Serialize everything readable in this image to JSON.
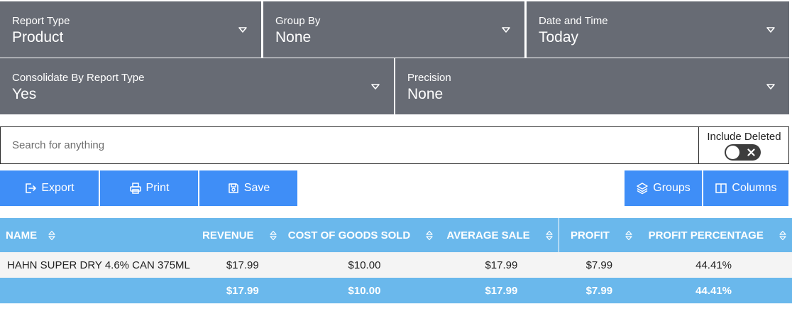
{
  "filters": {
    "report_type": {
      "label": "Report Type",
      "value": "Product"
    },
    "group_by": {
      "label": "Group By",
      "value": "None"
    },
    "date_time": {
      "label": "Date and Time",
      "value": "Today"
    },
    "consolidate": {
      "label": "Consolidate By Report Type",
      "value": "Yes"
    },
    "precision": {
      "label": "Precision",
      "value": "None"
    }
  },
  "search": {
    "placeholder": "Search for anything",
    "value": ""
  },
  "include_deleted": {
    "label": "Include Deleted",
    "enabled": false
  },
  "toolbar": {
    "export_label": "Export",
    "print_label": "Print",
    "save_label": "Save",
    "groups_label": "Groups",
    "columns_label": "Columns"
  },
  "table": {
    "columns": [
      "Name",
      "Revenue",
      "Cost of Goods Sold",
      "Average Sale",
      "Profit",
      "Profit Percentage"
    ],
    "rows": [
      {
        "name": "HAHN SUPER DRY 4.6% CAN 375ML",
        "revenue": "$17.99",
        "cogs": "$10.00",
        "average_sale": "$17.99",
        "profit": "$7.99",
        "profit_percentage": "44.41%"
      }
    ],
    "totals": {
      "name": "",
      "revenue": "$17.99",
      "cogs": "$10.00",
      "average_sale": "$17.99",
      "profit": "$7.99",
      "profit_percentage": "44.41%"
    }
  },
  "colors": {
    "filter_bg": "#676b74",
    "button_bg": "#3f8ef7",
    "table_header_bg": "#6ab8ec"
  }
}
